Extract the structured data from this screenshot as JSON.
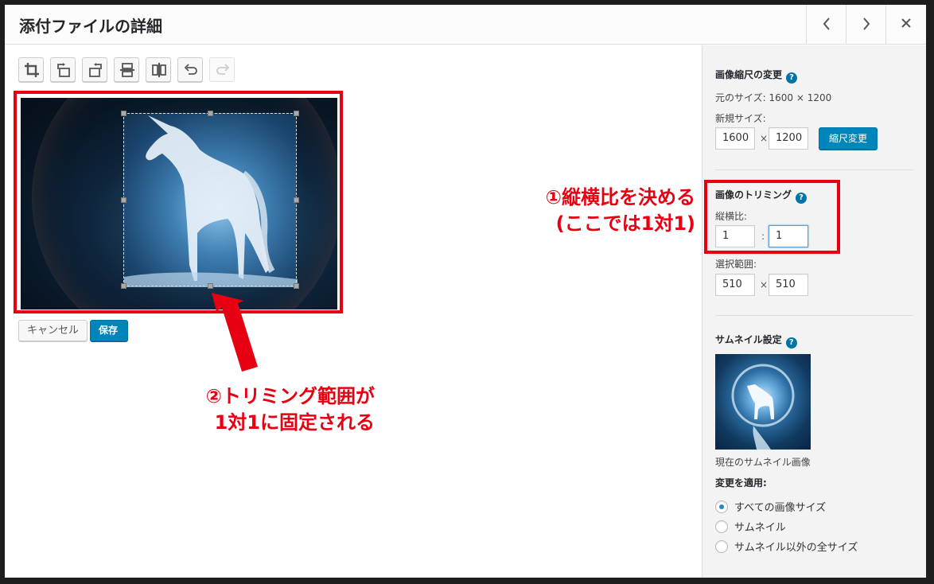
{
  "modal": {
    "title": "添付ファイルの詳細",
    "prev_icon": "chevron-left-icon",
    "next_icon": "chevron-right-icon",
    "close_icon": "close-icon"
  },
  "toolbar": {
    "tools": [
      "crop-icon",
      "rotate-left-icon",
      "rotate-right-icon",
      "flip-vertical-icon",
      "flip-horizontal-icon",
      "undo-icon",
      "redo-icon"
    ]
  },
  "editor": {
    "cancel_label": "キャンセル",
    "save_label": "保存"
  },
  "annotations": {
    "note1_line1": "①縦横比を決める",
    "note1_line2": "(ここでは1対1)",
    "note2_line1": "②トリミング範囲が",
    "note2_line2": "1対1に固定される",
    "annotation_color": "#e60012"
  },
  "scale": {
    "title": "画像縮尺の変更",
    "original_size": "元のサイズ: 1600 × 1200",
    "new_size_label": "新規サイズ:",
    "width": "1600",
    "times": "×",
    "height": "1200",
    "button_label": "縮尺変更"
  },
  "crop": {
    "title": "画像のトリミング",
    "aspect_label": "縦横比:",
    "aspect_w": "1",
    "colon": ":",
    "aspect_h": "1",
    "selection_label": "選択範囲:",
    "sel_w": "510",
    "times": "×",
    "sel_h": "510"
  },
  "thumbnail": {
    "title": "サムネイル設定",
    "caption": "現在のサムネイル画像",
    "apply_label": "変更を適用:",
    "options": [
      "すべての画像サイズ",
      "サムネイル",
      "サムネイル以外の全サイズ"
    ],
    "selected_index": 0
  },
  "colors": {
    "primary_button": "#0085ba",
    "help_icon": "#0073aa"
  }
}
